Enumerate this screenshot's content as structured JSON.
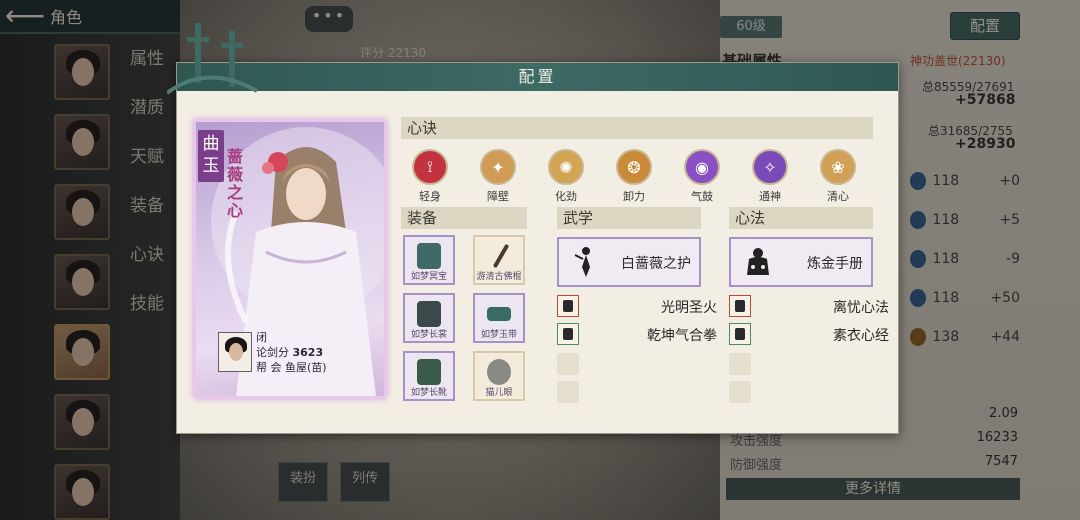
{
  "header": {
    "back_label": "角色"
  },
  "left_menu": {
    "items": [
      "属性",
      "潜质",
      "天赋",
      "装备",
      "心诀",
      "技能"
    ]
  },
  "chat": {
    "bubble": "•••"
  },
  "background": {
    "score_label": "评分 22130",
    "level": "60级",
    "config_button": "配置",
    "base_attr_title": "基础属性",
    "skill_name": "神功盖世(22130)",
    "total1": "总85559/27691",
    "total1_delta": "+57868",
    "total2": "总31685/2755",
    "total2_delta": "+28930",
    "stats": [
      {
        "val": "118",
        "delta": "+0"
      },
      {
        "val": "118",
        "delta": "+5"
      },
      {
        "val": "118",
        "delta": "-9"
      },
      {
        "val": "118",
        "delta": "+50"
      },
      {
        "val": "138",
        "delta": "+44"
      }
    ],
    "bottom_vals": [
      "2.09",
      "16233",
      "7547"
    ],
    "bottom_labels": [
      "攻击强度",
      "防御强度"
    ],
    "more_details": "更多详情",
    "tab_left": "装扮",
    "tab_right": "列传"
  },
  "dialog": {
    "title": "配置",
    "card": {
      "ribbon": "曲玉",
      "name": "蔷薇之心",
      "status": "闭",
      "score": "论剑分 3623",
      "score_label": "论剑分",
      "score_value": "3623",
      "guild_prefix": "帮",
      "guild": "会 鱼屋(苗)"
    },
    "sections": {
      "xinjue": "心诀",
      "equipment": "装备",
      "wuxue": "武学",
      "xinfa": "心法"
    },
    "xinjue_items": [
      {
        "label": "轻身",
        "color": "#c2333f"
      },
      {
        "label": "障壁",
        "color": "#d19a55"
      },
      {
        "label": "化劲",
        "color": "#d4a455"
      },
      {
        "label": "卸力",
        "color": "#c98a3a"
      },
      {
        "label": "气鼓",
        "color": "#8a4fc4"
      },
      {
        "label": "通神",
        "color": "#7a4ab8"
      },
      {
        "label": "清心",
        "color": "#d1a055"
      }
    ],
    "equipment": [
      {
        "name": "如梦冥宝",
        "color": "#3f6a6a",
        "plain": false
      },
      {
        "name": "游清古佛棍",
        "color": "#4a3a2a",
        "plain": true
      },
      {
        "name": "如梦长裳",
        "color": "#3a4a4a",
        "plain": false
      },
      {
        "name": "如梦玉带",
        "color": "#3a6a66",
        "plain": false
      },
      {
        "name": "如梦长靴",
        "color": "#3a5a4a",
        "plain": false
      },
      {
        "name": "猫儿眼",
        "color": "#8a8a84",
        "plain": true
      }
    ],
    "wuxue": {
      "main": "白蔷薇之护",
      "items": [
        "光明圣火",
        "乾坤气合拳"
      ]
    },
    "xinfa": {
      "main": "炼金手册",
      "items": [
        "离忧心法",
        "素衣心经"
      ]
    }
  }
}
